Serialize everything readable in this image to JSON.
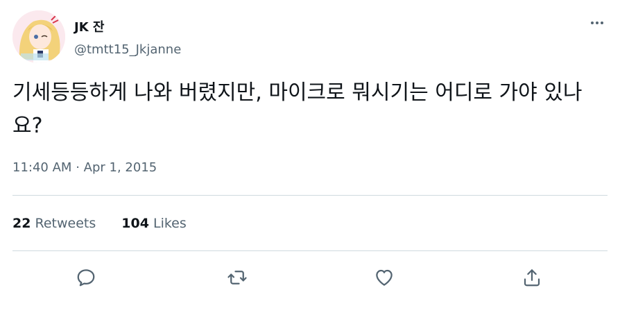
{
  "tweet": {
    "display_name": "JK 잔",
    "handle": "@tmtt15_Jkjanne",
    "text": "기세등등하게 나와 버렸지만, 마이크로 뭐시기는 어디로 가야 있나요?",
    "time": "11:40 AM",
    "separator": "·",
    "date": "Apr 1, 2015"
  },
  "stats": {
    "retweets_count": "22",
    "retweets_label": "Retweets",
    "likes_count": "104",
    "likes_label": "Likes"
  },
  "icons": {
    "more": "more-icon",
    "reply": "reply-icon",
    "retweet": "retweet-icon",
    "like": "heart-icon",
    "share": "share-icon"
  },
  "colors": {
    "text": "#0f1419",
    "secondary": "#536471",
    "divider": "#cfd9de"
  }
}
